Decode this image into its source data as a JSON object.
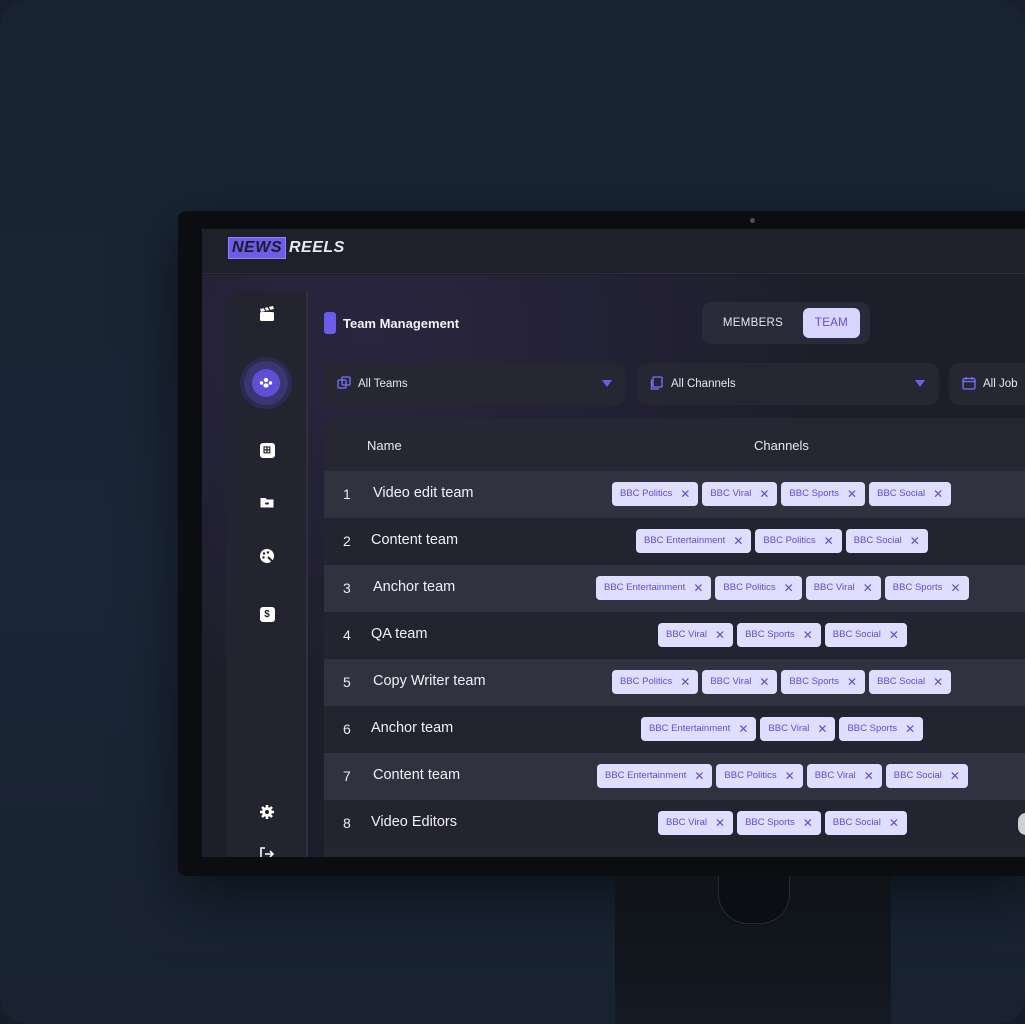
{
  "app": {
    "logo_left": "NEWS",
    "logo_right": "REELS"
  },
  "page": {
    "title": "Team Management"
  },
  "toggle": {
    "members": "MEMBERS",
    "team": "TEAM",
    "active": "TEAM"
  },
  "filters": [
    {
      "label": "All Teams",
      "icon": "layers-icon"
    },
    {
      "label": "All Channels",
      "icon": "copy-icon"
    },
    {
      "label": "All Job",
      "icon": "calendar-icon"
    }
  ],
  "table": {
    "headers": {
      "name": "Name",
      "channels": "Channels"
    },
    "rows": [
      {
        "num": "1",
        "name": "Video edit team",
        "channels": [
          "BBC Politics",
          "BBC Viral",
          "BBC Sports",
          "BBC Social"
        ]
      },
      {
        "num": "2",
        "name": "Content team",
        "channels": [
          "BBC Entertainment",
          "BBC Politics",
          "BBC Social"
        ]
      },
      {
        "num": "3",
        "name": "Anchor team",
        "channels": [
          "BBC Entertainment",
          "BBC Politics",
          "BBC Viral",
          "BBC Sports"
        ]
      },
      {
        "num": "4",
        "name": "QA team",
        "channels": [
          "BBC Viral",
          "BBC Sports",
          "BBC Social"
        ]
      },
      {
        "num": "5",
        "name": "Copy Writer team",
        "channels": [
          "BBC Politics",
          "BBC Viral",
          "BBC Sports",
          "BBC Social"
        ]
      },
      {
        "num": "6",
        "name": "Anchor team",
        "channels": [
          "BBC Entertainment",
          "BBC Viral",
          "BBC Sports"
        ]
      },
      {
        "num": "7",
        "name": "Content team",
        "channels": [
          "BBC Entertainment",
          "BBC Politics",
          "BBC Viral",
          "BBC Social"
        ]
      },
      {
        "num": "8",
        "name": "Video Editors",
        "channels": [
          "BBC Viral",
          "BBC Sports",
          "BBC Social"
        ]
      }
    ]
  },
  "sidebar": {
    "items": [
      "clapperboard-icon",
      "team-icon",
      "grid-icon",
      "folder-icon",
      "palette-icon",
      "dollar-icon",
      "settings-icon",
      "logout-icon"
    ]
  },
  "colors": {
    "accent": "#6c5ce7",
    "chip_bg": "#e0ddff",
    "chip_text": "#5b50d6"
  }
}
